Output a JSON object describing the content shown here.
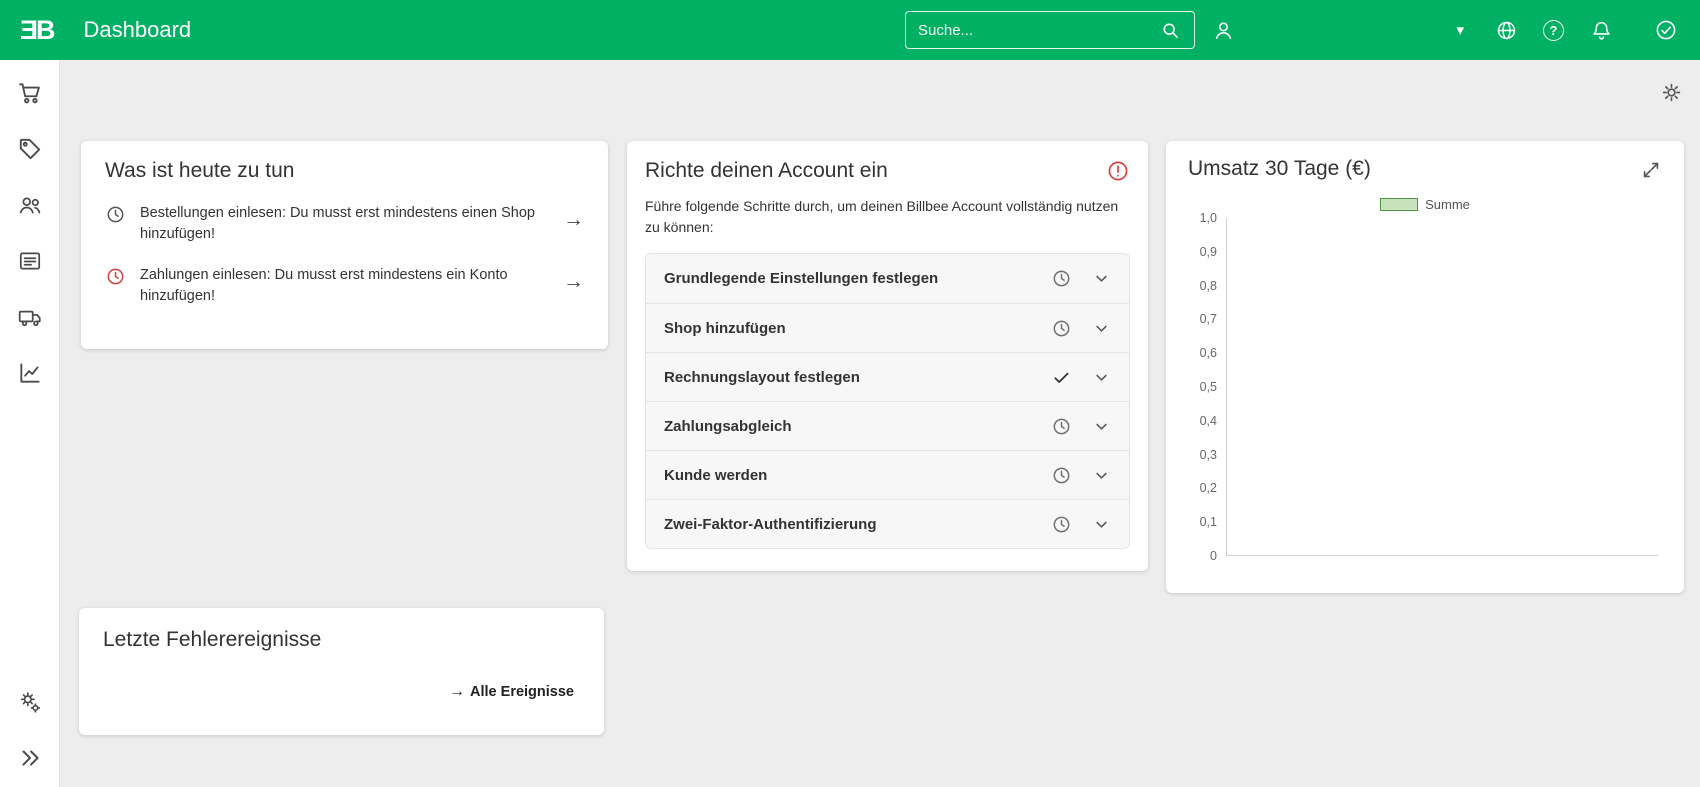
{
  "colors": {
    "brand_green": "#00B163",
    "alert_red": "#D43F3F",
    "legend_fill": "#C8E2BE",
    "legend_border": "#4C9A41"
  },
  "icons": {
    "logo": "ƎB",
    "caret_down": "▾",
    "question": "?",
    "arrow_right": "→"
  },
  "header": {
    "title": "Dashboard",
    "search": {
      "placeholder": "Suche..."
    }
  },
  "sidebar": {
    "items": [
      {
        "name": "orders"
      },
      {
        "name": "products"
      },
      {
        "name": "customers"
      },
      {
        "name": "invoices"
      },
      {
        "name": "shipping"
      },
      {
        "name": "reports"
      }
    ],
    "bottom": [
      {
        "name": "settings"
      },
      {
        "name": "collapse-expand"
      }
    ]
  },
  "content": {
    "todo_card": {
      "title": "Was ist heute zu tun",
      "items": [
        {
          "text": "Bestellungen einlesen: Du musst erst mindestens einen Shop hinzufügen!",
          "status": "pending"
        },
        {
          "text": "Zahlungen einlesen: Du musst erst mindestens ein Konto hinzufügen!",
          "status": "overdue"
        }
      ]
    },
    "setup_card": {
      "title": "Richte deinen Account ein",
      "intro": "Führe folgende Schritte durch, um deinen Billbee Account vollständig nutzen zu können:",
      "steps": [
        {
          "label": "Grundlegende Einstellungen festlegen",
          "state": "pending"
        },
        {
          "label": "Shop hinzufügen",
          "state": "pending"
        },
        {
          "label": "Rechnungslayout festlegen",
          "state": "done"
        },
        {
          "label": "Zahlungsabgleich",
          "state": "pending"
        },
        {
          "label": "Kunde werden",
          "state": "pending"
        },
        {
          "label": "Zwei-Faktor-Authentifizierung",
          "state": "pending"
        }
      ]
    },
    "chart_card": {
      "title": "Umsatz 30 Tage (€)",
      "chart_data": {
        "type": "line",
        "title": "Umsatz 30 Tage (€)",
        "series": [
          {
            "name": "Summe",
            "values": []
          }
        ],
        "x": [],
        "ylim": [
          0,
          1.0
        ],
        "yticks": [
          "1,0",
          "0,9",
          "0,8",
          "0,7",
          "0,6",
          "0,5",
          "0,4",
          "0,3",
          "0,2",
          "0,1",
          "0"
        ],
        "legend_position": "top",
        "grid": false
      }
    },
    "errors_card": {
      "title": "Letzte Fehlerereignisse",
      "link_label": "Alle Ereignisse"
    }
  }
}
